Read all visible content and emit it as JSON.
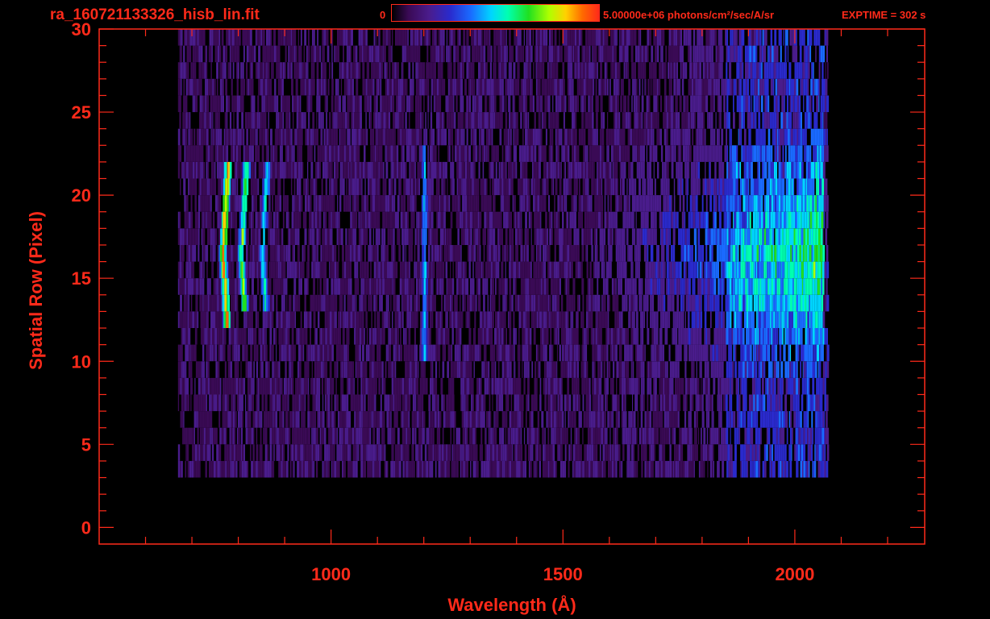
{
  "header": {
    "filename": "ra_160721133326_hisb_lin.fit",
    "colorbar_min": "0",
    "colorbar_max": "5.00000e+06 photons/cm²/sec/A/sr",
    "exptime": "EXPTIME = 302 s"
  },
  "colors": {
    "axis": "#ff2a1a",
    "background": "#000000",
    "colormap": [
      "#3a0a55",
      "#4a1c8c",
      "#2a2acc",
      "#1a6aff",
      "#00d5ff",
      "#00ffb0",
      "#20e020",
      "#b0ff00",
      "#ffd000",
      "#ff6a00",
      "#ff2a1a"
    ]
  },
  "chart_data": {
    "type": "heatmap",
    "title": "ra_160721133326_hisb_lin.fit",
    "xlabel": "Wavelength (Å)",
    "ylabel": "Spatial Row (Pixel)",
    "xlim": [
      500,
      2280
    ],
    "ylim": [
      -1,
      30
    ],
    "xticks": [
      1000,
      1500,
      2000
    ],
    "yticks": [
      0,
      5,
      10,
      15,
      20,
      25,
      30
    ],
    "colorbar_range": [
      0,
      5000000
    ],
    "colorbar_units": "photons/cm²/sec/A/sr",
    "exptime_s": 302,
    "data_extent": {
      "wavelength": [
        670,
        2070
      ],
      "rows": [
        3,
        30
      ]
    },
    "features": [
      {
        "wavelength": 765,
        "rows": [
          12,
          21
        ],
        "intensity": 1.0
      },
      {
        "wavelength": 805,
        "rows": [
          13,
          21
        ],
        "intensity": 0.72
      },
      {
        "wavelength": 850,
        "rows": [
          13,
          21
        ],
        "intensity": 0.55
      },
      {
        "wavelength": 1200,
        "rows": [
          10,
          22
        ],
        "intensity": 0.45
      },
      {
        "wavelength_range": [
          1700,
          2060
        ],
        "rows": [
          9,
          23
        ],
        "intensity": 0.6
      }
    ]
  }
}
